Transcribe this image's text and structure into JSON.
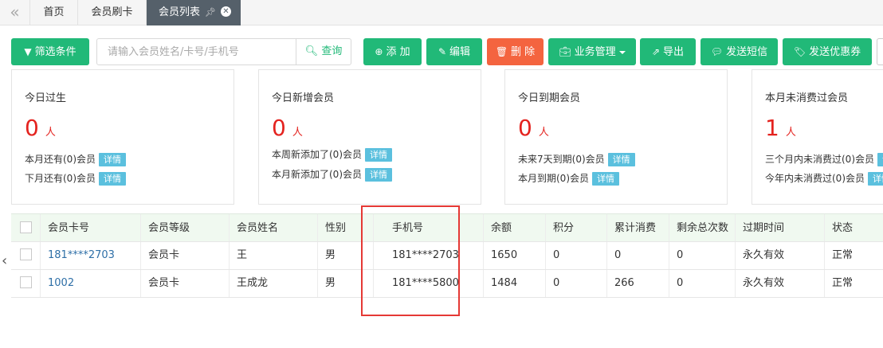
{
  "tabs": {
    "items": [
      {
        "label": "首页"
      },
      {
        "label": "会员刷卡"
      },
      {
        "label": "会员列表"
      }
    ]
  },
  "toolbar": {
    "filter_label": "筛选条件",
    "search_placeholder": "请输入会员姓名/卡号/手机号",
    "search_value": "",
    "query_label": "查询",
    "add_label": "添 加",
    "edit_label": "编辑",
    "delete_label": "删 除",
    "business_label": "业务管理",
    "export_label": "导出",
    "sms_label": "发送短信",
    "coupon_label": "发送优惠券"
  },
  "cards": [
    {
      "title": "今日过生",
      "count": "0",
      "unit": "人",
      "lines": [
        {
          "text": "本月还有(0)会员",
          "action": "详情"
        },
        {
          "text": "下月还有(0)会员",
          "action": "详情"
        }
      ]
    },
    {
      "title": "今日新增会员",
      "count": "0",
      "unit": "人",
      "lines": [
        {
          "text": "本周新添加了(0)会员",
          "action": "详情"
        },
        {
          "text": "本月新添加了(0)会员",
          "action": "详情"
        }
      ]
    },
    {
      "title": "今日到期会员",
      "count": "0",
      "unit": "人",
      "lines": [
        {
          "text": "未来7天到期(0)会员",
          "action": "详情"
        },
        {
          "text": "本月到期(0)会员",
          "action": "详情"
        }
      ]
    },
    {
      "title": "本月未消费过会员",
      "count": "1",
      "unit": "人",
      "lines": [
        {
          "text": "三个月内未消费过(0)会员",
          "action": "详情"
        },
        {
          "text": "今年内未消费过(0)会员",
          "action": "详情"
        }
      ]
    }
  ],
  "table": {
    "columns": [
      "会员卡号",
      "会员等级",
      "会员姓名",
      "性别",
      "手机号",
      "余额",
      "积分",
      "累计消费",
      "剩余总次数",
      "过期时间",
      "状态"
    ],
    "rows": [
      {
        "card_no": "181****2703",
        "level": "会员卡",
        "name": "王",
        "sex": "男",
        "phone": "181****2703",
        "balance": "1650",
        "points": "0",
        "accumulated": "0",
        "remaining": "0",
        "expire": "永久有效",
        "status": "正常"
      },
      {
        "card_no": "1002",
        "level": "会员卡",
        "name": "王成龙",
        "sex": "男",
        "phone": "181****5800",
        "balance": "1484",
        "points": "0",
        "accumulated": "266",
        "remaining": "0",
        "expire": "永久有效",
        "status": "正常"
      }
    ]
  },
  "colors": {
    "primary_green": "#21b978",
    "danger_orange": "#f4643f",
    "count_red": "#e4231f",
    "detail_blue": "#5bc0de",
    "active_tab": "#55606a",
    "highlight_red": "#e53935"
  },
  "icons": {
    "collapse": "double-chevron-left-icon",
    "filter": "funnel-icon",
    "search": "search-icon",
    "add": "plus-circle-icon",
    "edit": "pencil-square-icon",
    "delete": "trash-icon",
    "business": "briefcase-icon",
    "export": "share-icon",
    "sms": "chat-bubble-icon",
    "coupon": "tag-icon",
    "pin": "pin-icon",
    "close": "close-icon",
    "scroll_left": "chevron-left-icon"
  }
}
